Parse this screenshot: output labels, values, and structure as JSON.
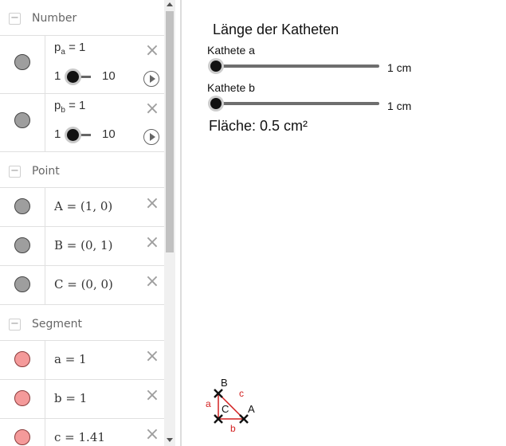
{
  "algebra": {
    "groups": {
      "number": {
        "label": "Number",
        "toggle": "−"
      },
      "point": {
        "label": "Point",
        "toggle": "−"
      },
      "segment": {
        "label": "Segment",
        "toggle": "−"
      }
    },
    "numbers": [
      {
        "name": "p",
        "sub": "a",
        "expr": " = 1",
        "min": "1",
        "max": "10",
        "value_fraction": 0.0
      },
      {
        "name": "p",
        "sub": "b",
        "expr": " = 1",
        "min": "1",
        "max": "10",
        "value_fraction": 0.0
      }
    ],
    "points": [
      {
        "formula": "A = (1, 0)"
      },
      {
        "formula": "B = (0, 1)"
      },
      {
        "formula": "C = (0, 0)"
      }
    ],
    "segments": [
      {
        "formula": "a = 1"
      },
      {
        "formula": "b = 1"
      },
      {
        "formula": "c = 1.41"
      }
    ],
    "close_glyph": "×"
  },
  "graphics": {
    "title": "Länge der Katheten",
    "sliders": [
      {
        "label": "Kathete a",
        "value": "1 cm",
        "fraction": 0.0
      },
      {
        "label": "Kathete b",
        "value": "1 cm",
        "fraction": 0.0
      }
    ],
    "area": "Fläche: 0.5 cm²",
    "construction": {
      "points": {
        "A": "A",
        "B": "B",
        "C": "C"
      },
      "segments": {
        "a": "a",
        "b": "b",
        "c": "c"
      }
    }
  },
  "colors": {
    "point_marble": "#9e9e9e",
    "segment_marble": "#f49a9a",
    "segment_line": "#d32020",
    "point_mark": "#111111"
  }
}
